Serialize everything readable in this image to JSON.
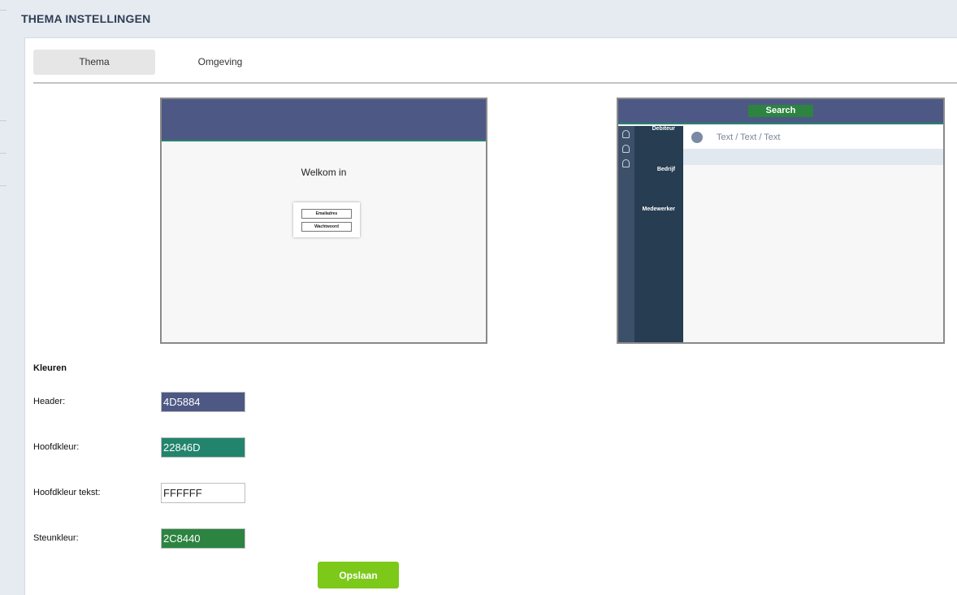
{
  "page": {
    "title": "THEMA INSTELLINGEN"
  },
  "tabs": [
    {
      "label": "Thema",
      "active": true
    },
    {
      "label": "Omgeving",
      "active": false
    }
  ],
  "preview_login": {
    "welcome_text": "Welkom in",
    "email_field": "Emailadres",
    "password_field": "Wachtwoord"
  },
  "preview_app": {
    "search_label": "Search",
    "sidebar": [
      "Debiteur",
      "Bedrijf",
      "Medewerker"
    ],
    "rail_icons": [
      "user-icon",
      "user-icon",
      "user-icon"
    ],
    "row_text": "Text / Text / Text"
  },
  "colors_section": {
    "title": "Kleuren",
    "fields": [
      {
        "label": "Header:",
        "value": "4D5884",
        "swatch": "#4D5884"
      },
      {
        "label": "Hoofdkleur:",
        "value": "22846D",
        "swatch": "#22846D"
      },
      {
        "label": "Hoofdkleur tekst:",
        "value": "FFFFFF",
        "swatch": "#FFFFFF"
      },
      {
        "label": "Steunkleur:",
        "value": "2C8440",
        "swatch": "#2C8440"
      }
    ]
  },
  "save_label": "Opslaan"
}
